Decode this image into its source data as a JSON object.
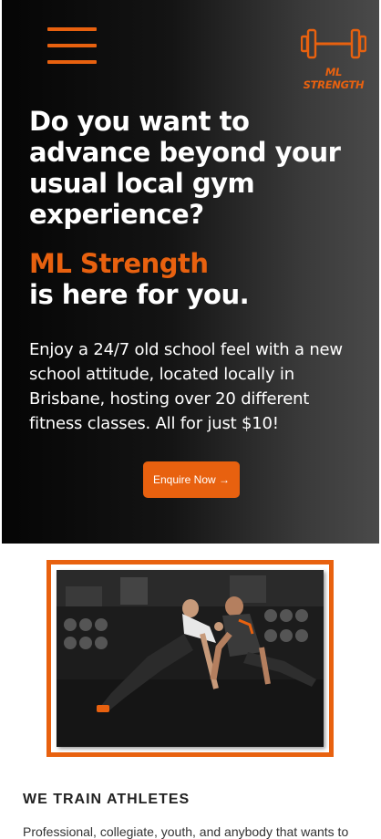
{
  "header": {
    "menu_icon": "hamburger-menu-icon",
    "logo_icon": "dumbbell-icon",
    "logo_text": "ML STRENGTH"
  },
  "hero": {
    "headline": "Do you want to advance beyond your usual local gym experience?",
    "brand_line": "ML Strength",
    "sub_line": "is here for you.",
    "intro": "Enjoy a 24/7 old school feel with a new school attitude, located locally in Brisbane, hosting over 20 different fitness classes. All for just $10!",
    "cta_label": "Enquire Now →"
  },
  "section": {
    "title": "WE TRAIN ATHLETES",
    "text": "Professional, collegiate, youth, and anybody that wants to"
  },
  "colors": {
    "accent": "#e8610f",
    "hero_bg": "#0a0a0a",
    "text_light": "#ffffff",
    "text_dark": "#222222"
  }
}
